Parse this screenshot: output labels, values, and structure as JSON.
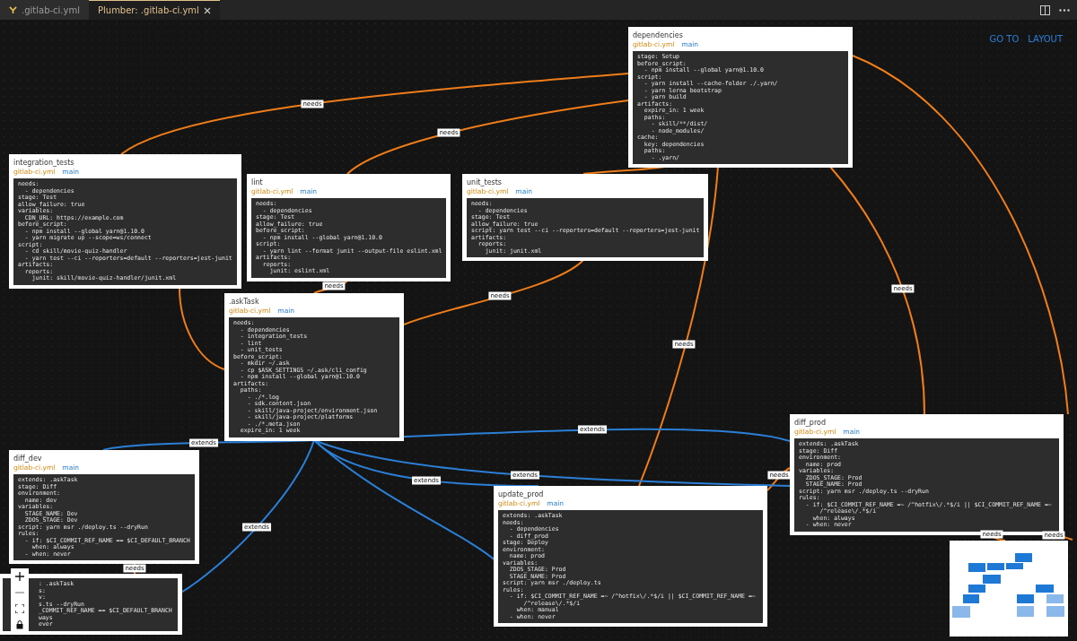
{
  "tabs": [
    {
      "label": ".gitlab-ci.yml",
      "selected": false
    },
    {
      "label": "Plumber: .gitlab-ci.yml",
      "selected": true
    }
  ],
  "toolbar_links": [
    "GO TO",
    "LAYOUT"
  ],
  "nodes": [
    {
      "title": "dependencies",
      "file": "gitlab-ci.yml",
      "branch": "main",
      "code": [
        "stage: Setup",
        "before_script:",
        "  - npm install --global yarn@1.10.0",
        "script:",
        "  - yarn install --cache-folder ./.yarn/",
        "  - yarn lerna bootstrap",
        "  - yarn build",
        "artifacts:",
        "  expire_in: 1 week",
        "  paths:",
        "    - skill/**/dist/",
        "    - node_modules/",
        "cache:",
        "  key: dependencies",
        "  paths:",
        "    - .yarn/"
      ]
    },
    {
      "title": "integration_tests",
      "file": "gitlab-ci.yml",
      "branch": "main",
      "code": [
        "needs:",
        "  - dependencies",
        "stage: Test",
        "allow_failure: true",
        "variables:",
        "  CDN_URL: https://example.com",
        "before_script:",
        "  - npm install --global yarn@1.10.0",
        "  - yarn migrate up --scope=ws/connect",
        "script:",
        "  - cd skill/movie-quiz-handler",
        "  - yarn test --ci --reporters=default --reporters=jest-junit",
        "artifacts:",
        "  reports:",
        "    junit: skill/movie-quiz-handler/junit.xml"
      ]
    },
    {
      "title": "lint",
      "file": "gitlab-ci.yml",
      "branch": "main",
      "code": [
        "needs:",
        "  - dependencies",
        "stage: Test",
        "allow_failure: true",
        "before_script:",
        "  - npm install --global yarn@1.10.0",
        "script:",
        "  - yarn lint --format junit --output-file eslint.xml",
        "artifacts:",
        "  reports:",
        "    junit: eslint.xml"
      ]
    },
    {
      "title": "unit_tests",
      "file": "gitlab-ci.yml",
      "branch": "main",
      "code": [
        "needs:",
        "  - dependencies",
        "stage: Test",
        "allow_failure: true",
        "script: yarn test --ci --reporters=default --reporters=jest-junit",
        "artifacts:",
        "  reports:",
        "    junit: junit.xml"
      ]
    },
    {
      "title": ".askTask",
      "file": "gitlab-ci.yml",
      "branch": "main",
      "code": [
        "needs:",
        "  - dependencies",
        "  - integration_tests",
        "  - lint",
        "  - unit_tests",
        "before_script:",
        "  - mkdir ~/.ask",
        "  - cp $ASK_SETTINGS ~/.ask/cli_config",
        "  - npm install --global yarn@1.10.0",
        "artifacts:",
        "  paths:",
        "    - ./*.log",
        "    - sdk.content.json",
        "    - skill/java-project/environment.json",
        "    - skill/java-project/platforms",
        "    - ./*.meta.json",
        "  expire_in: 1 week"
      ]
    },
    {
      "title": "diff_dev",
      "file": "gitlab-ci.yml",
      "branch": "main",
      "code": [
        "extends: .askTask",
        "stage: Diff",
        "environment:",
        "  name: dev",
        "variables:",
        "  STAGE_NAME: Dev",
        "  ZDOS_STAGE: Dev",
        "script: yarn msr ./deploy.ts --dryRun",
        "rules:",
        "  - if: $CI_COMMIT_REF_NAME == $CI_DEFAULT_BRANCH",
        "    when: always",
        "  - when: never"
      ]
    },
    {
      "title": "diff_prod",
      "file": "gitlab-ci.yml",
      "branch": "main",
      "code": [
        "extends: .askTask",
        "stage: Diff",
        "environment:",
        "  name: prod",
        "variables:",
        "  ZDOS_STAGE: Prod",
        "  STAGE_NAME: Prod",
        "script: yarn msr ./deploy.ts --dryRun",
        "rules:",
        "  - if: $CI_COMMIT_REF_NAME =~ /^hotfix\\/.*$/i || $CI_COMMIT_REF_NAME =~",
        "      /^release\\/.*$/i",
        "    when: always",
        "  - when: never"
      ]
    },
    {
      "code": [
        ": .askTask",
        "s:",
        "v:",
        "s.ts --dryRun",
        "_COMMIT_REF_NAME == $CI_DEFAULT_BRANCH",
        "ways",
        "ever"
      ]
    },
    {
      "title": "update_prod",
      "file": "gitlab-ci.yml",
      "branch": "main",
      "code": [
        "extends: .askTask",
        "needs:",
        "  - dependencies",
        "  - diff_prod",
        "stage: Deploy",
        "environment:",
        "  name: prod",
        "variables:",
        "  ZDOS_STAGE: Prod",
        "  STAGE_NAME: Prod",
        "script: yarn msr ./deploy.ts",
        "rules:",
        "  - if: $CI_COMMIT_REF_NAME =~ /^hotfix\\/.*$/i || $CI_COMMIT_REF_NAME =~",
        "      /^release\\/.*$/i",
        "    when: manual",
        "  - when: never"
      ]
    }
  ],
  "edges": [
    {
      "kind": "needs",
      "label": "needs"
    },
    {
      "kind": "needs",
      "label": "needs"
    },
    {
      "kind": "needs",
      "label": "needs"
    },
    {
      "kind": "needs",
      "label": "needs"
    },
    {
      "kind": "needs",
      "label": "needs"
    },
    {
      "kind": "needs",
      "label": "needs"
    },
    {
      "kind": "needs",
      "label": "needs"
    },
    {
      "kind": "needs",
      "label": "needs"
    },
    {
      "kind": "needs",
      "label": "needs"
    },
    {
      "kind": "needs",
      "label": "needs"
    },
    {
      "kind": "extends",
      "label": "extends"
    },
    {
      "kind": "extends",
      "label": "extends"
    },
    {
      "kind": "extends",
      "label": "extends"
    },
    {
      "kind": "extends",
      "label": "extends"
    },
    {
      "kind": "extends",
      "label": "extends"
    },
    {
      "kind": "extends"
    },
    {
      "kind": "needs"
    },
    {
      "kind": "needs"
    },
    {
      "kind": "needs"
    }
  ]
}
